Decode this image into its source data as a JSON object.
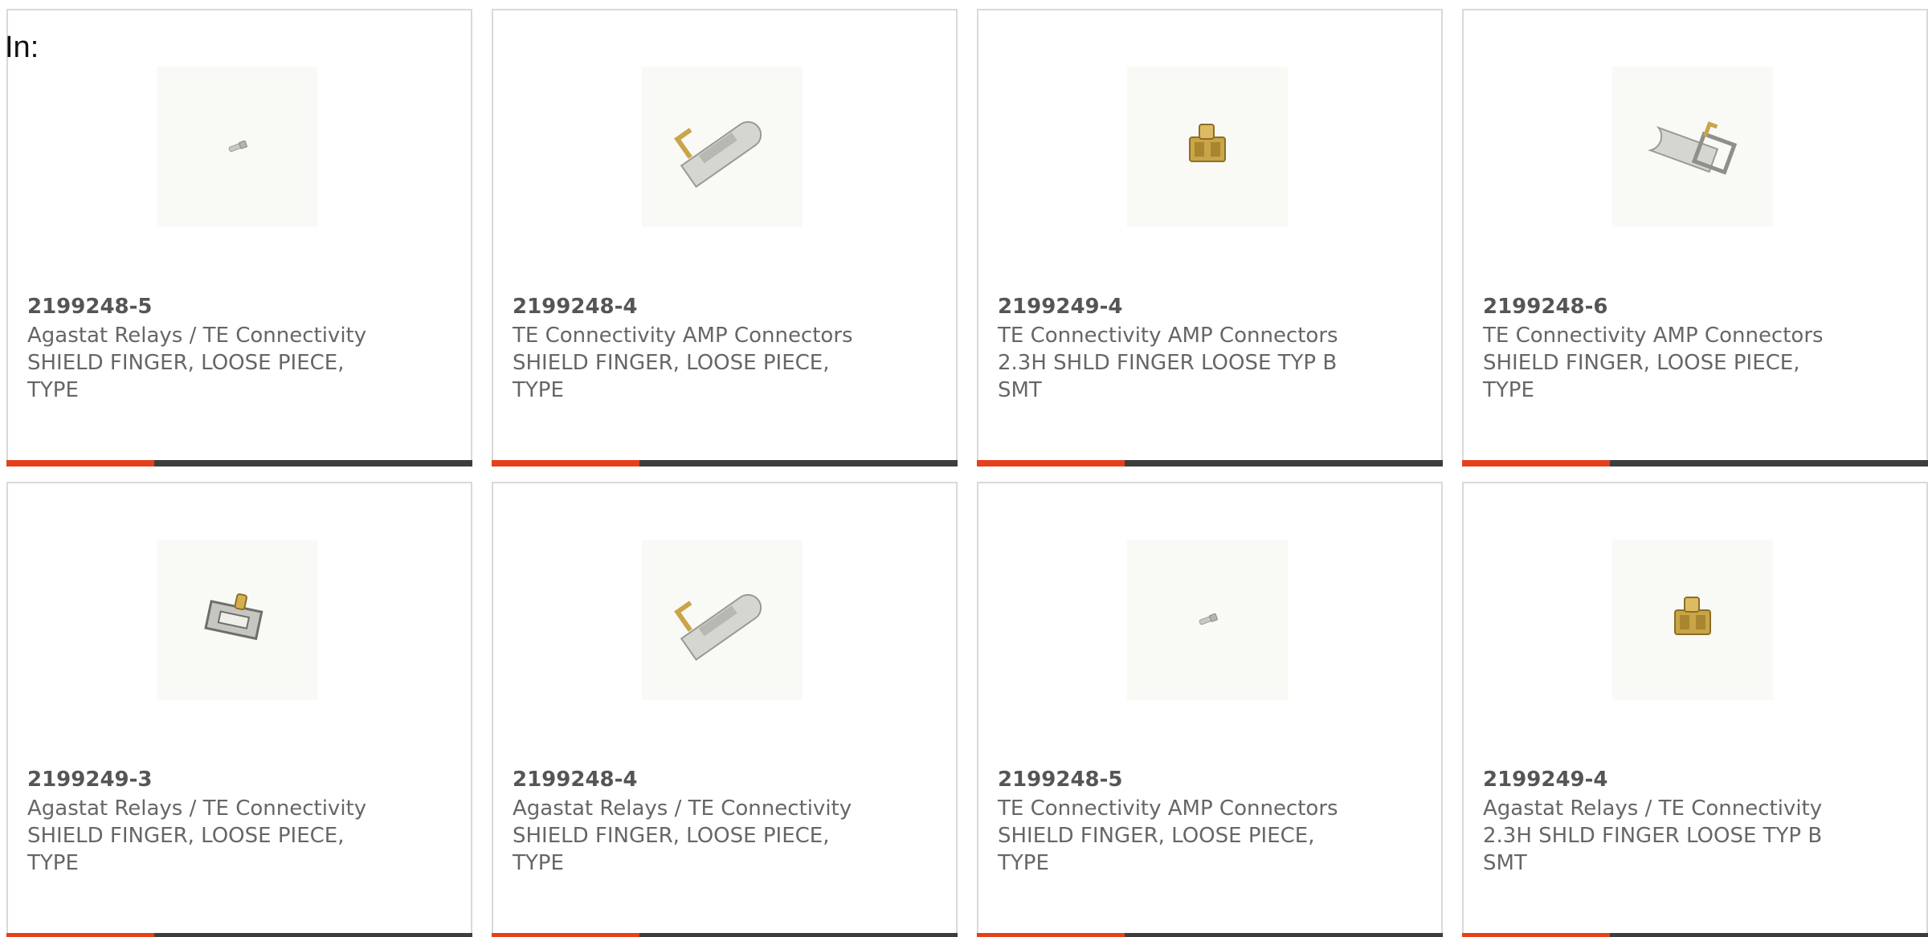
{
  "page": {
    "heading": "In:"
  },
  "colors": {
    "accent": "#e5401c",
    "bar": "#3d3d3d",
    "border": "#d9d9d9",
    "text": "#666666"
  },
  "products": [
    {
      "part_number": "2199248-5",
      "manufacturer": "Agastat Relays / TE Connectivity",
      "description": "SHIELD FINGER, LOOSE PIECE,\nTYPE",
      "image_icon": "small-shield-finger-icon"
    },
    {
      "part_number": "2199248-4",
      "manufacturer": "TE Connectivity AMP Connectors",
      "description": "SHIELD FINGER, LOOSE PIECE,\nTYPE",
      "image_icon": "shield-finger-long-icon"
    },
    {
      "part_number": "2199249-4",
      "manufacturer": "TE Connectivity AMP Connectors",
      "description": "2.3H SHLD FINGER LOOSE TYP B\nSMT",
      "image_icon": "gold-shield-finger-icon"
    },
    {
      "part_number": "2199248-6",
      "manufacturer": "TE Connectivity AMP Connectors",
      "description": "SHIELD FINGER, LOOSE PIECE,\nTYPE",
      "image_icon": "shield-finger-clip-icon"
    },
    {
      "part_number": "2199249-3",
      "manufacturer": "Agastat Relays / TE Connectivity",
      "description": "SHIELD FINGER, LOOSE PIECE,\nTYPE",
      "image_icon": "shield-finger-box-icon"
    },
    {
      "part_number": "2199248-4",
      "manufacturer": "Agastat Relays / TE Connectivity",
      "description": "SHIELD FINGER, LOOSE PIECE,\nTYPE",
      "image_icon": "shield-finger-long-icon"
    },
    {
      "part_number": "2199248-5",
      "manufacturer": "TE Connectivity AMP Connectors",
      "description": "SHIELD FINGER, LOOSE PIECE,\nTYPE",
      "image_icon": "small-shield-finger-icon"
    },
    {
      "part_number": "2199249-4",
      "manufacturer": "Agastat Relays / TE Connectivity",
      "description": "2.3H SHLD FINGER LOOSE TYP B\nSMT",
      "image_icon": "gold-shield-finger-icon"
    }
  ]
}
